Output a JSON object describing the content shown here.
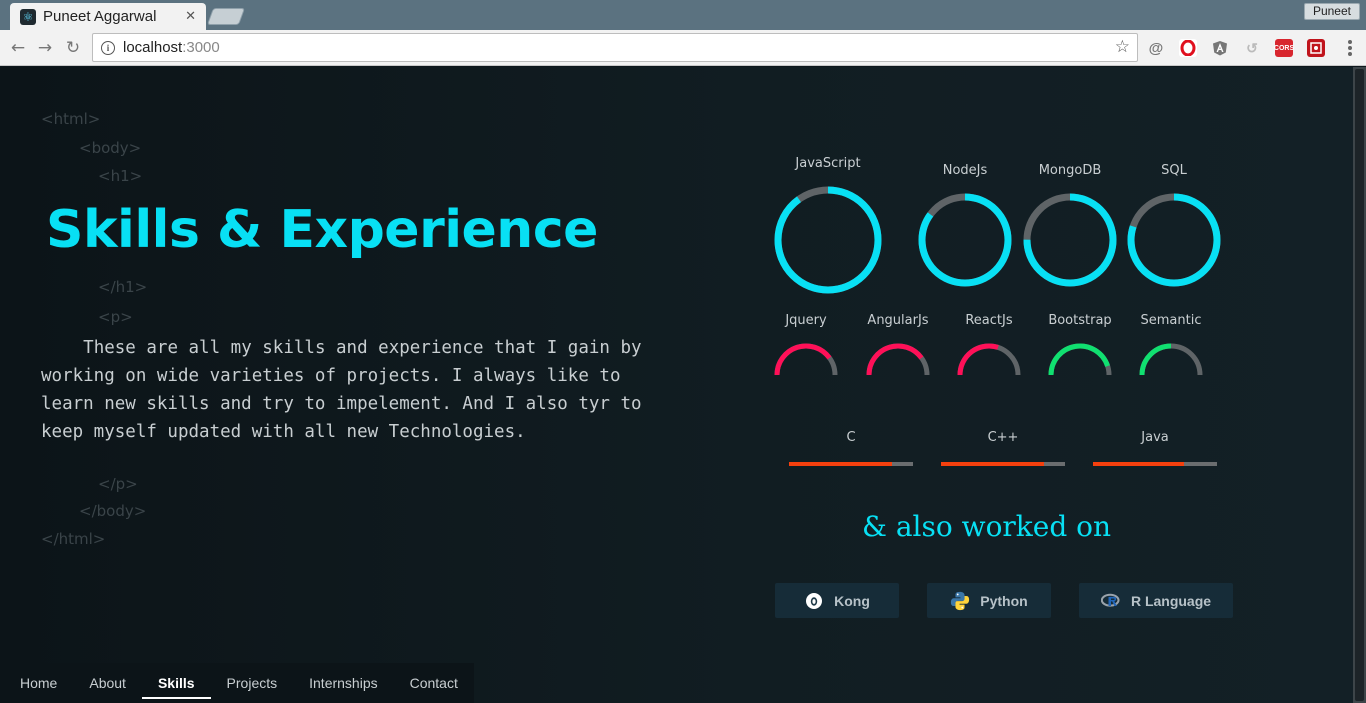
{
  "browser": {
    "tab_title": "Puneet Aggarwal",
    "tab_close": "✕",
    "profile_name": "Puneet",
    "url_host": "localhost",
    "url_port": ":3000",
    "extensions": [
      "at-icon",
      "opera-icon",
      "angular-icon",
      "refresh-ext-icon",
      "cors-icon",
      "screenshot-icon"
    ],
    "cors_label": "CORS"
  },
  "code_tags": {
    "html_open": "<html>",
    "body_open": "<body>",
    "h1_open": "<h1>",
    "h1_close": "</h1>",
    "p_open": "<p>",
    "p_close": "</p>",
    "body_close": "</body>",
    "html_close": "</html>"
  },
  "heading": "Skills & Experience",
  "description": "    These are all my skills and experience that I gain by working on wide varieties of projects. I always like to learn new skills and try to impelement. And I also tyr to keep myself updated with all new Technologies.",
  "colors": {
    "accent": "#08e0f4",
    "circle_track": "#5f6467",
    "pink": "#ff1058",
    "green": "#10e070",
    "orange": "#f5400e"
  },
  "circle_skills": [
    {
      "name": "JavaScript",
      "level": 0.9
    },
    {
      "name": "NodeJs",
      "level": 0.85
    },
    {
      "name": "MongoDB",
      "level": 0.75
    },
    {
      "name": "SQL",
      "level": 0.8
    }
  ],
  "arc_skills": [
    {
      "name": "Jquery",
      "level": 0.8,
      "color": "pink"
    },
    {
      "name": "AngularJs",
      "level": 0.8,
      "color": "pink"
    },
    {
      "name": "ReactJs",
      "level": 0.6,
      "color": "pink"
    },
    {
      "name": "Bootstrap",
      "level": 0.9,
      "color": "green"
    },
    {
      "name": "Semantic",
      "level": 0.5,
      "color": "green"
    }
  ],
  "languages": [
    {
      "name": "C",
      "level": 0.83
    },
    {
      "name": "C++",
      "level": 0.83
    },
    {
      "name": "Java",
      "level": 0.73
    }
  ],
  "also_heading": "& also worked on",
  "also_worked": [
    {
      "name": "Kong",
      "icon": "kong-icon"
    },
    {
      "name": "Python",
      "icon": "python-icon"
    },
    {
      "name": "R Language",
      "icon": "r-language-icon"
    }
  ],
  "nav": {
    "items": [
      "Home",
      "About",
      "Skills",
      "Projects",
      "Internships",
      "Contact"
    ],
    "active": "Skills"
  }
}
